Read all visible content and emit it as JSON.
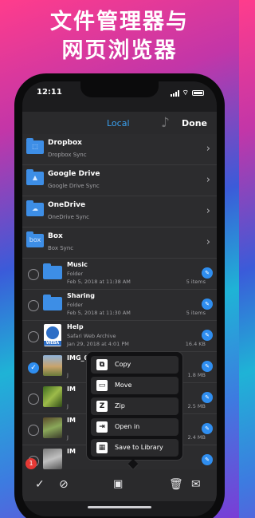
{
  "headline": {
    "line1": "文件管理器与",
    "line2": "网页浏览器"
  },
  "status": {
    "time": "12:11"
  },
  "nav": {
    "title": "Local",
    "done": "Done"
  },
  "cloud": [
    {
      "name": "Dropbox",
      "sub": "Dropbox Sync"
    },
    {
      "name": "Google Drive",
      "sub": "Google Drive Sync"
    },
    {
      "name": "OneDrive",
      "sub": "OneDrive Sync"
    },
    {
      "name": "Box",
      "sub": "Box Sync",
      "logo": "box"
    }
  ],
  "files": [
    {
      "name": "Music",
      "kind": "Folder",
      "date": "Feb 5, 2018 at 11:38 AM",
      "size": "5 items"
    },
    {
      "name": "Sharing",
      "kind": "Folder",
      "date": "Feb 5, 2018 at 11:30 AM",
      "size": "5 items"
    },
    {
      "name": "Help",
      "kind": "Safari Web Archive",
      "date": "Jan 29, 2018 at 4:01 PM",
      "size": "16.4 KB",
      "badge": "WEBA"
    },
    {
      "name": "IMG_0001",
      "kind": "",
      "date": "J",
      "size": "1.8 MB"
    },
    {
      "name": "IM",
      "kind": "",
      "date": "J",
      "size": "2.5 MB"
    },
    {
      "name": "IM",
      "kind": "",
      "date": "J",
      "size": "2.4 MB"
    },
    {
      "name": "IM",
      "kind": "",
      "date": "",
      "size": ""
    }
  ],
  "menu": {
    "copy": "Copy",
    "move": "Move",
    "zip": "Zip",
    "open_in": "Open in",
    "save": "Save to Library"
  },
  "toolbar": {
    "badge": "1"
  }
}
